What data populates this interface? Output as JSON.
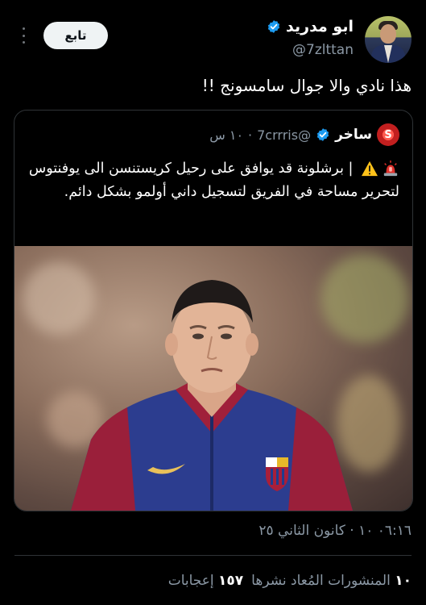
{
  "author": {
    "display_name": "ابو مدريد",
    "handle": "@7zlttan",
    "verified": true,
    "avatar": "profile-photo"
  },
  "follow_button": {
    "label": "تابع"
  },
  "more_menu": {
    "icon": "more-vertical-icon"
  },
  "tweet": {
    "text": "هذا نادي والا جوال سامسونج !!"
  },
  "quoted_tweet": {
    "author": {
      "display_name": "ساخر",
      "avatar_text": "S",
      "handle": "@7crrris",
      "verified": true
    },
    "time_ago": "١٠ س",
    "text_prefix_icons": [
      "siren-icon",
      "warning-icon"
    ],
    "text": "| برشلونة قد يوافق على رحيل كريستنسن الى يوفنتوس لتحرير مساحة في الفريق لتسجيل داني أولمو بشكل دائم.",
    "media": {
      "type": "photo",
      "description_icon": "player-photo"
    }
  },
  "timestamp": "٠٦:١٦ ١٠ · كانون الثاني ٢٥",
  "stats": [
    {
      "value": "١٠",
      "label": "المنشورات المُعاد نشرها"
    },
    {
      "value": "١٥٧",
      "label": "إعجابات"
    }
  ],
  "colors": {
    "background": "#000000",
    "text_primary": "#e7e9ea",
    "text_secondary": "#8b98a5",
    "verified_blue": "#1d9bf0",
    "border": "#2f3336"
  }
}
